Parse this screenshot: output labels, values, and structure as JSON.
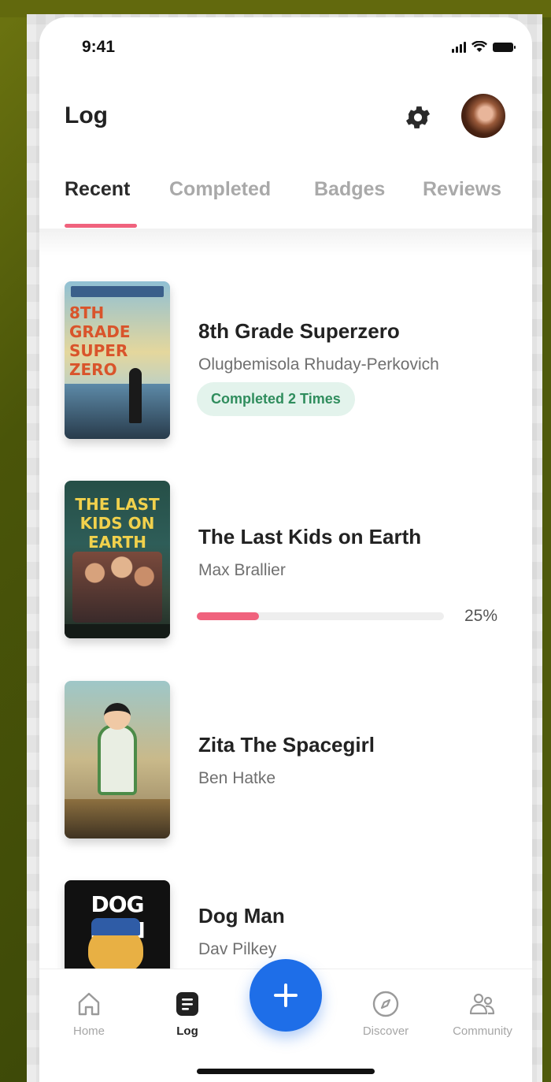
{
  "status_bar": {
    "time": "9:41"
  },
  "header": {
    "title": "Log"
  },
  "tabs": [
    {
      "label": "Recent",
      "active": true
    },
    {
      "label": "Completed",
      "active": false
    },
    {
      "label": "Badges",
      "active": false
    },
    {
      "label": "Reviews",
      "active": false
    }
  ],
  "books": [
    {
      "title": "8th Grade Superzero",
      "author": "Olugbemisola Rhuday-Perkovich",
      "badge": "Completed 2 Times",
      "cover_text": "8TH GRADE SUPER ZERO"
    },
    {
      "title": "The Last Kids on Earth",
      "author": "Max Brallier",
      "progress": 0.25,
      "progress_label": "25%",
      "cover_text": "THE LAST KIDS ON EARTH"
    },
    {
      "title": "Zita The Spacegirl",
      "author": "Ben Hatke"
    },
    {
      "title": "Dog Man",
      "author": "Dav Pilkey",
      "cover_text": "DOG MAN"
    }
  ],
  "bottom_nav": [
    {
      "label": "Home",
      "icon": "home-icon",
      "active": false
    },
    {
      "label": "Log",
      "icon": "log-icon",
      "active": true
    },
    {
      "label": "Discover",
      "icon": "compass-icon",
      "active": false
    },
    {
      "label": "Community",
      "icon": "people-icon",
      "active": false
    }
  ],
  "fab": {
    "icon": "plus-icon"
  },
  "colors": {
    "accent": "#f0627d",
    "fab": "#1e6ee8",
    "badge_bg": "#e3f3ec",
    "badge_text": "#2f8d5d"
  }
}
